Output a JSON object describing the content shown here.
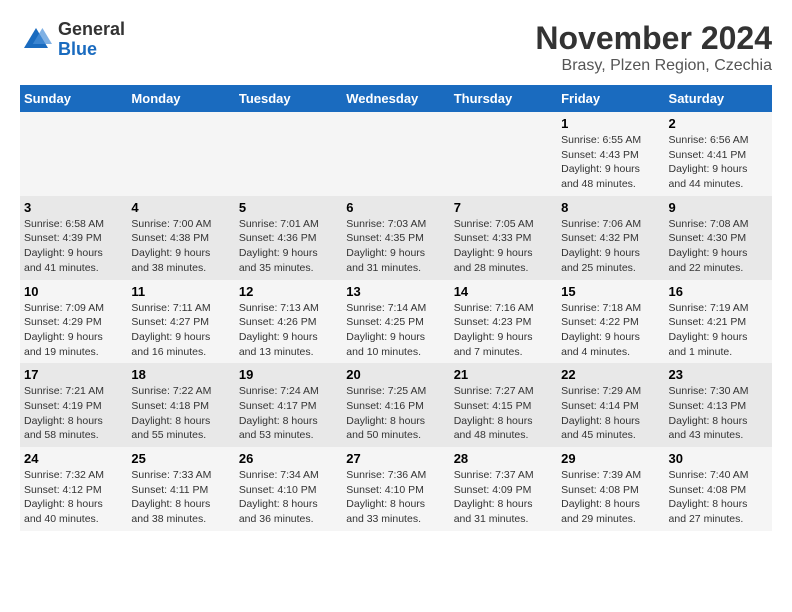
{
  "logo": {
    "general": "General",
    "blue": "Blue"
  },
  "title": "November 2024",
  "subtitle": "Brasy, Plzen Region, Czechia",
  "days_of_week": [
    "Sunday",
    "Monday",
    "Tuesday",
    "Wednesday",
    "Thursday",
    "Friday",
    "Saturday"
  ],
  "weeks": [
    [
      {
        "day": "",
        "info": ""
      },
      {
        "day": "",
        "info": ""
      },
      {
        "day": "",
        "info": ""
      },
      {
        "day": "",
        "info": ""
      },
      {
        "day": "",
        "info": ""
      },
      {
        "day": "1",
        "info": "Sunrise: 6:55 AM\nSunset: 4:43 PM\nDaylight: 9 hours\nand 48 minutes."
      },
      {
        "day": "2",
        "info": "Sunrise: 6:56 AM\nSunset: 4:41 PM\nDaylight: 9 hours\nand 44 minutes."
      }
    ],
    [
      {
        "day": "3",
        "info": "Sunrise: 6:58 AM\nSunset: 4:39 PM\nDaylight: 9 hours\nand 41 minutes."
      },
      {
        "day": "4",
        "info": "Sunrise: 7:00 AM\nSunset: 4:38 PM\nDaylight: 9 hours\nand 38 minutes."
      },
      {
        "day": "5",
        "info": "Sunrise: 7:01 AM\nSunset: 4:36 PM\nDaylight: 9 hours\nand 35 minutes."
      },
      {
        "day": "6",
        "info": "Sunrise: 7:03 AM\nSunset: 4:35 PM\nDaylight: 9 hours\nand 31 minutes."
      },
      {
        "day": "7",
        "info": "Sunrise: 7:05 AM\nSunset: 4:33 PM\nDaylight: 9 hours\nand 28 minutes."
      },
      {
        "day": "8",
        "info": "Sunrise: 7:06 AM\nSunset: 4:32 PM\nDaylight: 9 hours\nand 25 minutes."
      },
      {
        "day": "9",
        "info": "Sunrise: 7:08 AM\nSunset: 4:30 PM\nDaylight: 9 hours\nand 22 minutes."
      }
    ],
    [
      {
        "day": "10",
        "info": "Sunrise: 7:09 AM\nSunset: 4:29 PM\nDaylight: 9 hours\nand 19 minutes."
      },
      {
        "day": "11",
        "info": "Sunrise: 7:11 AM\nSunset: 4:27 PM\nDaylight: 9 hours\nand 16 minutes."
      },
      {
        "day": "12",
        "info": "Sunrise: 7:13 AM\nSunset: 4:26 PM\nDaylight: 9 hours\nand 13 minutes."
      },
      {
        "day": "13",
        "info": "Sunrise: 7:14 AM\nSunset: 4:25 PM\nDaylight: 9 hours\nand 10 minutes."
      },
      {
        "day": "14",
        "info": "Sunrise: 7:16 AM\nSunset: 4:23 PM\nDaylight: 9 hours\nand 7 minutes."
      },
      {
        "day": "15",
        "info": "Sunrise: 7:18 AM\nSunset: 4:22 PM\nDaylight: 9 hours\nand 4 minutes."
      },
      {
        "day": "16",
        "info": "Sunrise: 7:19 AM\nSunset: 4:21 PM\nDaylight: 9 hours\nand 1 minute."
      }
    ],
    [
      {
        "day": "17",
        "info": "Sunrise: 7:21 AM\nSunset: 4:19 PM\nDaylight: 8 hours\nand 58 minutes."
      },
      {
        "day": "18",
        "info": "Sunrise: 7:22 AM\nSunset: 4:18 PM\nDaylight: 8 hours\nand 55 minutes."
      },
      {
        "day": "19",
        "info": "Sunrise: 7:24 AM\nSunset: 4:17 PM\nDaylight: 8 hours\nand 53 minutes."
      },
      {
        "day": "20",
        "info": "Sunrise: 7:25 AM\nSunset: 4:16 PM\nDaylight: 8 hours\nand 50 minutes."
      },
      {
        "day": "21",
        "info": "Sunrise: 7:27 AM\nSunset: 4:15 PM\nDaylight: 8 hours\nand 48 minutes."
      },
      {
        "day": "22",
        "info": "Sunrise: 7:29 AM\nSunset: 4:14 PM\nDaylight: 8 hours\nand 45 minutes."
      },
      {
        "day": "23",
        "info": "Sunrise: 7:30 AM\nSunset: 4:13 PM\nDaylight: 8 hours\nand 43 minutes."
      }
    ],
    [
      {
        "day": "24",
        "info": "Sunrise: 7:32 AM\nSunset: 4:12 PM\nDaylight: 8 hours\nand 40 minutes."
      },
      {
        "day": "25",
        "info": "Sunrise: 7:33 AM\nSunset: 4:11 PM\nDaylight: 8 hours\nand 38 minutes."
      },
      {
        "day": "26",
        "info": "Sunrise: 7:34 AM\nSunset: 4:10 PM\nDaylight: 8 hours\nand 36 minutes."
      },
      {
        "day": "27",
        "info": "Sunrise: 7:36 AM\nSunset: 4:10 PM\nDaylight: 8 hours\nand 33 minutes."
      },
      {
        "day": "28",
        "info": "Sunrise: 7:37 AM\nSunset: 4:09 PM\nDaylight: 8 hours\nand 31 minutes."
      },
      {
        "day": "29",
        "info": "Sunrise: 7:39 AM\nSunset: 4:08 PM\nDaylight: 8 hours\nand 29 minutes."
      },
      {
        "day": "30",
        "info": "Sunrise: 7:40 AM\nSunset: 4:08 PM\nDaylight: 8 hours\nand 27 minutes."
      }
    ]
  ]
}
